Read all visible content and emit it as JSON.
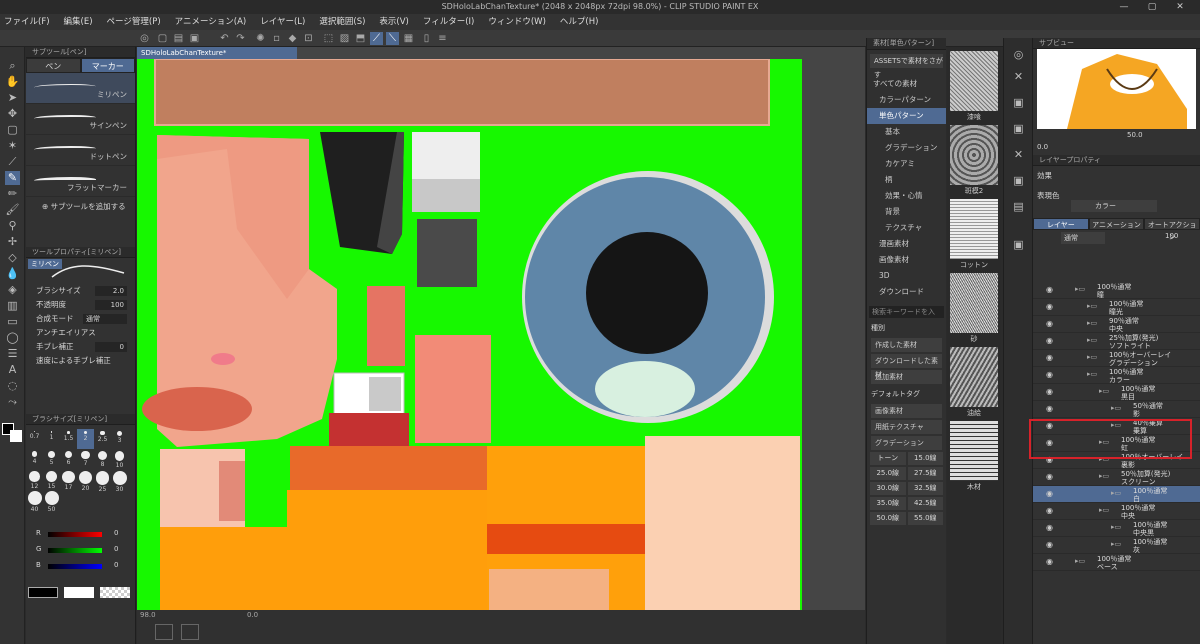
{
  "window": {
    "title": "SDHoloLabChanTexture* (2048 x 2048px 72dpi 98.0%) - CLIP STUDIO PAINT EX",
    "buttons": [
      "—",
      "▢",
      "✕"
    ]
  },
  "menu": [
    "ファイル(F)",
    "編集(E)",
    "ページ管理(P)",
    "アニメーション(A)",
    "レイヤー(L)",
    "選択範囲(S)",
    "表示(V)",
    "フィルター(I)",
    "ウィンドウ(W)",
    "ヘルプ(H)"
  ],
  "subtool": {
    "header": "サブツール[ペン]",
    "tabs": [
      "ペン",
      "マーカー"
    ],
    "brushes": [
      "ミリペン",
      "サインペン",
      "ドットペン",
      "フラットマーカー"
    ],
    "add_label": "サブツールを追加する"
  },
  "toolprop": {
    "header": "ツールプロパティ[ミリペン]",
    "name": "ミリペン",
    "brush_size_label": "ブラシサイズ",
    "brush_size": "2.0",
    "opacity_label": "不透明度",
    "opacity": "100",
    "blend_label": "合成モード",
    "blend": "通常",
    "antialias_label": "アンチエイリアス",
    "stabil_label": "手ブレ補正",
    "stabil": "0",
    "speed_label": "速度による手ブレ補正"
  },
  "brushsize": {
    "header": "ブラシサイズ[ミリペン]",
    "sizes": [
      "0.7",
      "1",
      "1.5",
      "2",
      "2.5",
      "3",
      "4",
      "5",
      "6",
      "7",
      "8",
      "10",
      "12",
      "15",
      "17",
      "20",
      "25",
      "30",
      "40",
      "50"
    ]
  },
  "color": {
    "r_label": "R",
    "g_label": "G",
    "b_label": "B",
    "r": "0",
    "g": "0",
    "b": "0",
    "side": [
      "RGB",
      "HSV",
      "CMY"
    ]
  },
  "doc_tab": "SDHoloLabChanTexture*",
  "status": {
    "zoom": "98.0",
    "coords": "0.0"
  },
  "material": {
    "header": "素材[単色パターン]",
    "assets_btn": "ASSETSで素材をさがす",
    "tree": [
      "すべての素材",
      "カラーパターン",
      "単色パターン",
      "基本",
      "グラデーション",
      "カケアミ",
      "柄",
      "効果・心情",
      "背景",
      "テクスチャ",
      "漫画素材",
      "画像素材",
      "3D",
      "ダウンロード"
    ],
    "search_placeholder": "検索キーワードを入",
    "kind_label": "種別",
    "kinds": [
      "作成した素材",
      "ダウンロードした素材",
      "追加素材"
    ],
    "default_tag_label": "デフォルトタグ",
    "tags": [
      "画像素材",
      "用紙テクスチャ",
      "グラデーション"
    ],
    "tones": [
      [
        "トーン",
        "15.0線"
      ],
      [
        "25.0線",
        "27.5線"
      ],
      [
        "30.0線",
        "32.5線"
      ],
      [
        "35.0線",
        "42.5線"
      ],
      [
        "50.0線",
        "55.0線"
      ]
    ]
  },
  "thumbs": [
    "漆喰",
    "斑模2",
    "コットン",
    "砂",
    "油絵",
    "木材"
  ],
  "navigator": {
    "header": "サブビュー",
    "zoom": "50.0",
    "angle": "0.0"
  },
  "layerprop": {
    "header": "レイヤープロパティ",
    "effect_label": "効果",
    "color_label": "表現色",
    "color_value": "カラー"
  },
  "layers_panel": {
    "tabs": [
      "レイヤー",
      "アニメーション",
      "オートアクション"
    ],
    "blend": "通常",
    "opacity": "100",
    "layers": [
      {
        "top": "100％通常",
        "name": "瞳",
        "indent": 0
      },
      {
        "top": "100％通常",
        "name": "瞳光",
        "indent": 1
      },
      {
        "top": "90％通常",
        "name": "中央",
        "indent": 1
      },
      {
        "top": "25％加算(発光)",
        "name": "ソフトライト",
        "indent": 1
      },
      {
        "top": "100％オーバーレイ",
        "name": "グラデーション",
        "indent": 1
      },
      {
        "top": "100％通常",
        "name": "カラー",
        "indent": 1
      },
      {
        "top": "100％通常",
        "name": "黒目",
        "indent": 2
      },
      {
        "top": "50％通常",
        "name": "影",
        "indent": 3
      },
      {
        "top": "40％乗算",
        "name": "乗算",
        "indent": 3
      },
      {
        "top": "100％通常",
        "name": "虹",
        "indent": 2
      },
      {
        "top": "100％オーバーレイ",
        "name": "裏影",
        "indent": 2
      },
      {
        "top": "50％加算(発光)",
        "name": "スクリーン",
        "indent": 2
      },
      {
        "top": "100％通常",
        "name": "白",
        "indent": 3
      },
      {
        "top": "100％通常",
        "name": "中央",
        "indent": 2
      },
      {
        "top": "100％通常",
        "name": "中央黒",
        "indent": 3
      },
      {
        "top": "100％通常",
        "name": "灰",
        "indent": 3
      },
      {
        "top": "100％通常",
        "name": "ベース",
        "indent": 0
      }
    ]
  }
}
